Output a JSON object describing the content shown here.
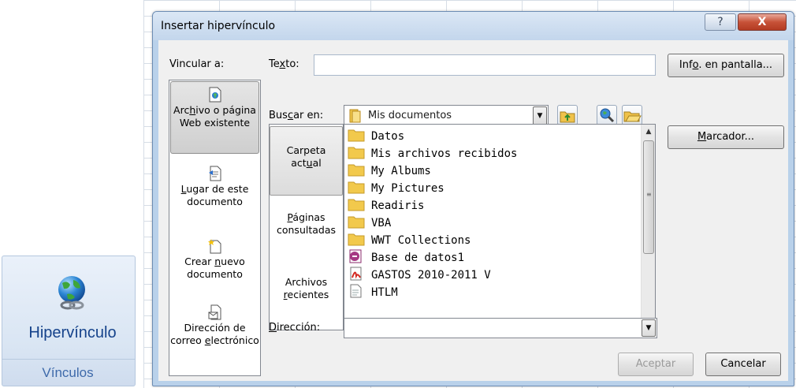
{
  "ribbon": {
    "button_label": "Hipervínculo",
    "group_label": "Vínculos",
    "icon": "globe-link-icon"
  },
  "dialog": {
    "title": "Insertar hipervínculo",
    "help_glyph": "?",
    "close_glyph": "X",
    "link_to_label": "Vincular a:",
    "link_to_items": [
      {
        "label_parts": [
          "Arc",
          "h",
          "ivo o página Web existente"
        ],
        "icon": "file-page-icon",
        "selected": true
      },
      {
        "label_parts": [
          "",
          "L",
          "ugar de este documento"
        ],
        "icon": "document-place-icon",
        "selected": false
      },
      {
        "label_parts": [
          "Crear ",
          "n",
          "uevo documento"
        ],
        "icon": "new-document-icon",
        "selected": false
      },
      {
        "label_parts": [
          "Dirección de correo ",
          "e",
          "lectrónico"
        ],
        "icon": "email-address-icon",
        "selected": false
      }
    ],
    "text_label_parts": [
      "Te",
      "x",
      "to:"
    ],
    "text_value": "",
    "screentip_button_parts": [
      "Inf",
      "o",
      ". en pantalla..."
    ],
    "lookin_label_parts": [
      "Bus",
      "c",
      "ar en:"
    ],
    "lookin_value": "Mis documentos",
    "lookin_icon": "documents-folder-icon",
    "toolbar_icons": [
      "up-folder-icon",
      "browse-web-icon",
      "browse-file-icon"
    ],
    "nav_items": [
      {
        "label_parts": [
          "Carpeta act",
          "u",
          "al"
        ],
        "selected": true
      },
      {
        "label_parts": [
          "",
          "P",
          "áginas consultadas"
        ],
        "selected": false
      },
      {
        "label_parts": [
          "Archivos ",
          "r",
          "ecientes"
        ],
        "selected": false
      }
    ],
    "files": [
      {
        "name": "Datos",
        "icon": "folder-icon"
      },
      {
        "name": "Mis archivos recibidos",
        "icon": "folder-icon"
      },
      {
        "name": "My Albums",
        "icon": "folder-icon"
      },
      {
        "name": "My Pictures",
        "icon": "folder-icon"
      },
      {
        "name": "Readiris",
        "icon": "folder-icon"
      },
      {
        "name": "VBA",
        "icon": "folder-icon"
      },
      {
        "name": "WWT Collections",
        "icon": "folder-icon"
      },
      {
        "name": "Base de datos1",
        "icon": "access-file-icon"
      },
      {
        "name": "GASTOS 2010-2011 V",
        "icon": "pdf-file-icon"
      },
      {
        "name": "HTLM",
        "icon": "html-file-icon"
      }
    ],
    "bookmark_button_parts": [
      "",
      "M",
      "arcador..."
    ],
    "address_label_parts": [
      "",
      "D",
      "irección:"
    ],
    "address_value": "",
    "ok_button": "Aceptar",
    "cancel_button": "Cancelar"
  }
}
